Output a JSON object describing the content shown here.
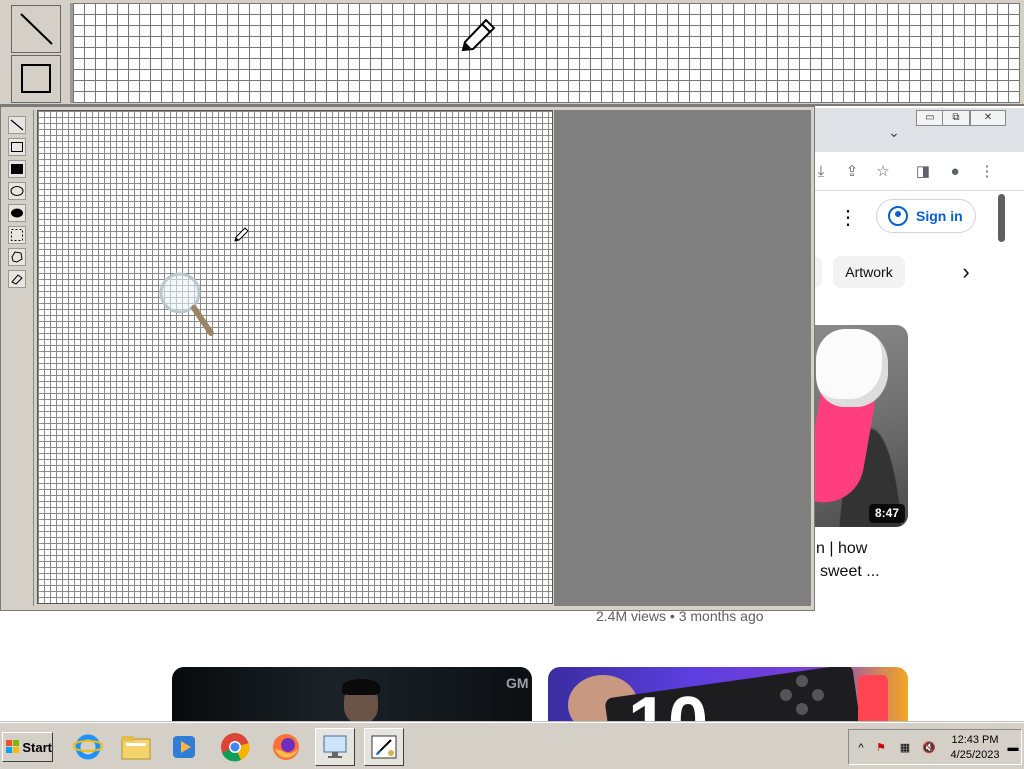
{
  "chrome": {
    "window_controls": {
      "minimize": "▭",
      "restore": "⧉",
      "close": "✕"
    },
    "tab_search_icon": "chevron-down-icon",
    "toolbar_icons": [
      "download-icon",
      "share-icon",
      "star-icon",
      "side-panel-icon",
      "profile-icon",
      "menu-dots-icon"
    ]
  },
  "youtube": {
    "more_icon": "⋮",
    "sign_in_label": "Sign in",
    "chips": [
      "Artwork"
    ],
    "chip_next_icon": "›",
    "video": {
      "duration": "8:47",
      "title_line1": "n | how",
      "title_line2": "sweet ...",
      "meta": "2.4M views • 3 months ago"
    },
    "thumb_left_badge": "GM",
    "thumb_right_text": "10"
  },
  "paint": {
    "tools": [
      "line-tool",
      "rectangle-tool",
      "filled-rectangle-tool",
      "ellipse-tool",
      "filled-ellipse-tool",
      "select-tool",
      "lasso-tool",
      "eraser-tool"
    ]
  },
  "zoom_panel": {
    "tools": [
      "line-tool",
      "rectangle-tool"
    ],
    "cursor_icon": "pencil-icon"
  },
  "taskbar": {
    "start_label": "Start",
    "apps": [
      "internet-explorer",
      "file-explorer",
      "media-player",
      "chrome",
      "firefox",
      "remote-desktop",
      "paint"
    ],
    "tray": {
      "time": "12:43 PM",
      "date": "4/25/2023",
      "expand_icon": "^"
    }
  },
  "colors": {
    "face": "#d4d0c8",
    "workspace": "#808080",
    "link_blue": "#065fd4",
    "accent_pink": "#ff3d7f"
  }
}
